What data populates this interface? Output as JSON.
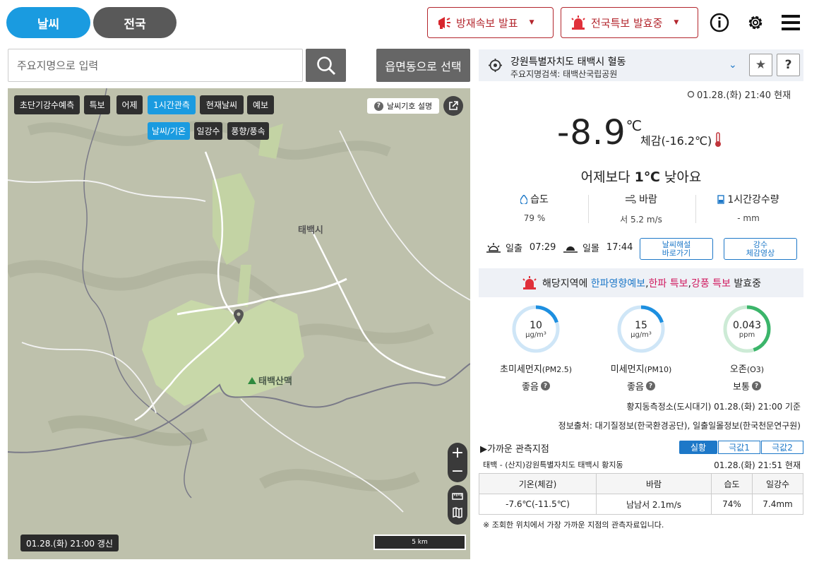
{
  "top": {
    "tab_weather": "날씨",
    "tab_nation": "전국",
    "btn_disaster": "방재속보 발표",
    "btn_nationwide": "전국특보 발효중"
  },
  "search": {
    "placeholder": "주요지명으로 입력",
    "select_label": "읍면동으로 선택"
  },
  "map": {
    "tabs": [
      "초단기강수예측",
      "특보",
      "어제",
      "1시간관측",
      "현재날씨",
      "예보"
    ],
    "subtabs": [
      "날씨/기온",
      "일강수",
      "풍향/풍속"
    ],
    "legend_btn": "날씨기호 설명",
    "label_city": "태백시",
    "label_mountain": "태백산맥",
    "updated": "01.28.(화) 21:00 갱신",
    "scale": "5 km"
  },
  "location": {
    "name": "강원특별자치도 태백시 혈동",
    "sub": "주요지명검색: 태백산국립공원"
  },
  "current": {
    "time": "01.28.(화) 21:40 현재",
    "temp": "-8.9",
    "unit": "℃",
    "feels": "체감(-16.2℃)",
    "compare_pre": "어제보다 ",
    "compare_val": "1℃",
    "compare_post": " 낮아요",
    "humidity_label": "습도",
    "humidity_value": "79 %",
    "wind_label": "바람",
    "wind_value": "서 5.2 m/s",
    "rain_label": "1시간강수량",
    "rain_value": "- mm",
    "sunrise_label": "일출",
    "sunrise": "07:29",
    "sunset_label": "일몰",
    "sunset": "17:44",
    "btn_explain": [
      "날씨해설",
      "바로가기"
    ],
    "btn_rain": [
      "강수",
      "체감영상"
    ]
  },
  "alert": {
    "pre": "해당지역에 ",
    "a1": "한파영향예보",
    "sep1": ",",
    "a2": "한파 특보",
    "sep2": ",",
    "a3": "강풍 특보",
    "post": " 발효중"
  },
  "air": [
    {
      "value": "10",
      "unit": "μg/m³",
      "label": "초미세먼지",
      "code": "(PM2.5)",
      "grade": "좋음",
      "fill": 0.2,
      "color": "#1d8fe0"
    },
    {
      "value": "15",
      "unit": "μg/m³",
      "label": "미세먼지",
      "code": "(PM10)",
      "grade": "좋음",
      "fill": 0.2,
      "color": "#1d8fe0"
    },
    {
      "value": "0.043",
      "unit": "ppm",
      "label": "오존",
      "code": "(O3)",
      "grade": "보통",
      "fill": 0.45,
      "color": "#3bb56a"
    }
  ],
  "station_note": "황지동측정소(도시대기) 01.28.(화) 21:00 기준",
  "source_note": "정보출처: 대기질정보(한국환경공단), 일출일몰정보(한국천문연구원)",
  "nearby": {
    "title": "▶가까운 관측지점",
    "tabs": [
      "실황",
      "극값1",
      "극값2"
    ],
    "station": "태백 - (산지)강원특별자치도 태백시 황지동",
    "time": "01.28.(화) 21:51 현재",
    "headers": [
      "기온(체감)",
      "바람",
      "습도",
      "일강수"
    ],
    "values": [
      "-7.6℃(-11.5℃)",
      "남남서 2.1m/s",
      "74%",
      "7.4mm"
    ],
    "footnote": "※ 조회한 위치에서 가장 가까운 지점의 관측자료입니다."
  }
}
